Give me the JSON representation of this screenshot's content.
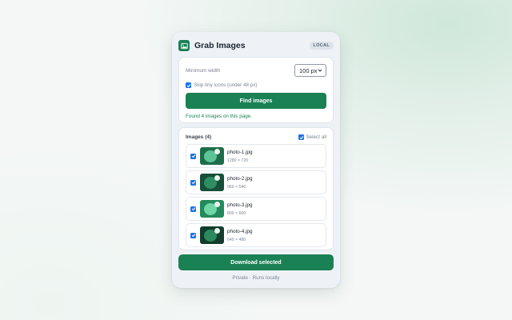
{
  "app": {
    "title": "Grab Images",
    "badge": "LOCAL",
    "logo_icon": "image-icon"
  },
  "settings": {
    "min_width_label": "Minimum width",
    "min_width_value": "100 px",
    "skip_label": "Skip tiny icons (under 48 px)",
    "skip_checked": true,
    "find_button": "Find images",
    "status": "Found 4 images on this page."
  },
  "images": {
    "title": "Images (4)",
    "select_all_label": "Select all",
    "select_all_checked": true,
    "items": [
      {
        "name": "photo-1.jpg",
        "dims": "1280 × 720",
        "checked": true
      },
      {
        "name": "photo-2.jpg",
        "dims": "960 × 540",
        "checked": true
      },
      {
        "name": "photo-3.jpg",
        "dims": "800 × 600",
        "checked": true
      },
      {
        "name": "photo-4.jpg",
        "dims": "640 × 480",
        "checked": true
      }
    ]
  },
  "download_button": "Download selected",
  "footer": "Private · Runs locally",
  "colors": {
    "accent": "#1a8154",
    "checkbox": "#1a73e8",
    "panel": "#eef2f6"
  }
}
